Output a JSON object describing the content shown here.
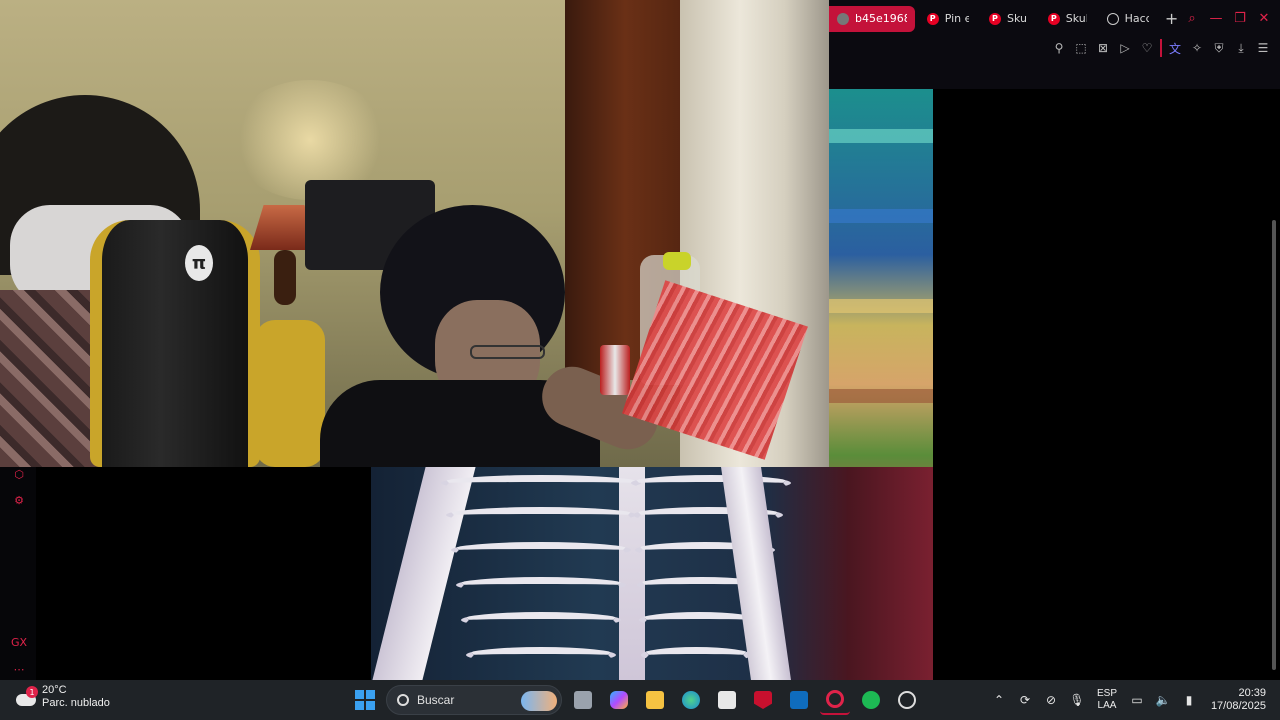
{
  "browser": {
    "tabs": [
      {
        "label": "b45e1968",
        "favicon": "ghost-icon",
        "active": true
      },
      {
        "label": "Pin e",
        "favicon": "pinterest-icon",
        "active": false
      },
      {
        "label": "Skul",
        "favicon": "pinterest-icon",
        "active": false
      },
      {
        "label": "Skul",
        "favicon": "pinterest-icon",
        "active": false
      },
      {
        "label": "Hacc",
        "favicon": "chatgpt-icon",
        "active": false
      }
    ],
    "new_tab": "+",
    "accent": "#c4123a"
  },
  "taskbar": {
    "weather": {
      "temp": "20°C",
      "condition": "Parc. nublado",
      "badge": "1"
    },
    "search_label": "Buscar",
    "language": {
      "line1": "ESP",
      "line2": "LAA"
    },
    "clock": {
      "time": "20:39",
      "date": "17/08/2025"
    }
  }
}
